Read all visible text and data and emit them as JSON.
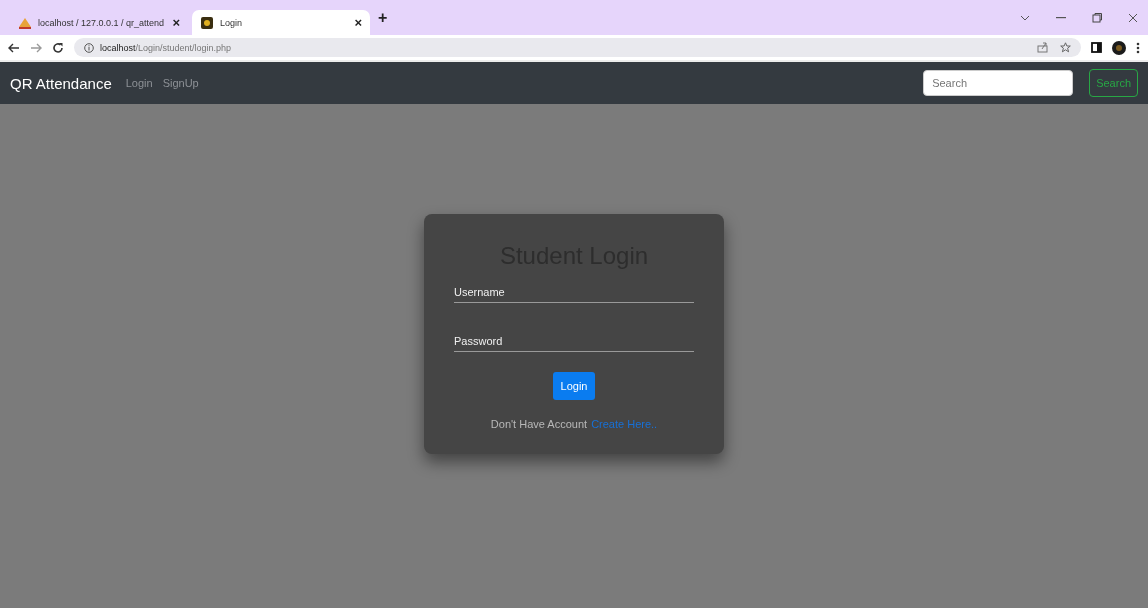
{
  "browser": {
    "tabs": [
      {
        "title": "localhost / 127.0.0.1 / qr_attend",
        "selected": false,
        "kind": "sail"
      },
      {
        "title": "Login",
        "selected": true,
        "kind": "square"
      }
    ],
    "new_tab": "+",
    "close": "×",
    "address": {
      "host": "localhost",
      "path": "/Login/student/login.php"
    }
  },
  "navbar": {
    "brand": "QR Attendance",
    "links": [
      "Login",
      "SignUp"
    ],
    "search": {
      "placeholder": "Search"
    },
    "search_button": "Search"
  },
  "login_card": {
    "title": "Student Login",
    "fields": [
      {
        "placeholder": "Username"
      },
      {
        "placeholder": "Password"
      }
    ],
    "button": "Login",
    "prompt": "Don't Have Account",
    "link": "Create Here.."
  }
}
